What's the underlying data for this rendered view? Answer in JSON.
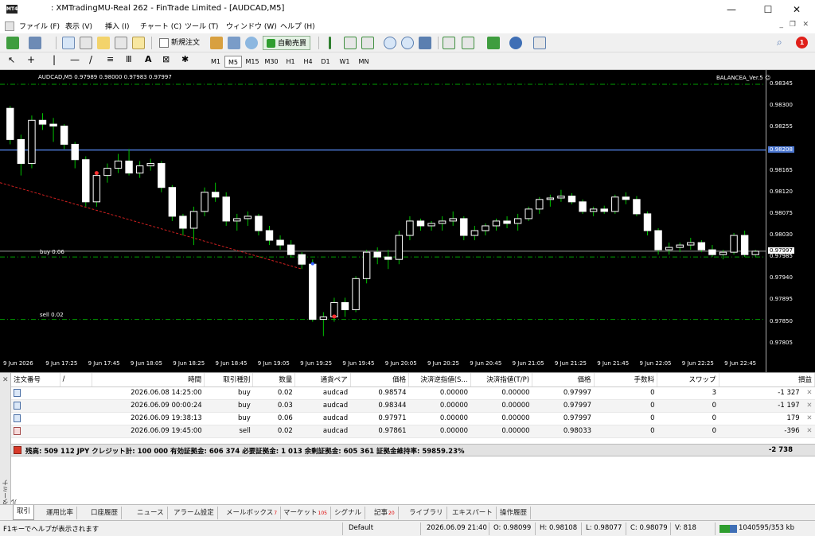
{
  "window": {
    "title": ": XMTradingMU-Real 262 - FinTrade Limited - [AUDCAD,M5]",
    "app_icon_text": "MT4",
    "controls": {
      "minimize": "—",
      "maximize": "☐",
      "close": "✕"
    }
  },
  "menu": [
    "ファイル (F)",
    "表示 (V)",
    "挿入 (I)",
    "チャート (C)",
    "ツール (T)",
    "ウィンドウ (W)",
    "ヘルプ (H)"
  ],
  "toolbar": {
    "new_order": "新規注文",
    "auto_trading": "自動売買",
    "notification_count": "1"
  },
  "timeframes": [
    "M1",
    "M5",
    "M15",
    "M30",
    "H1",
    "H4",
    "D1",
    "W1",
    "MN"
  ],
  "active_timeframe": "M5",
  "chart": {
    "info_header": "AUDCAD,M5 0.97989 0.98000 0.97983 0.97997",
    "ea_label": "BALANCEA_Ver.5",
    "colors": {
      "background": "#000000",
      "bull": "#ffffff",
      "bear": "#ffffff",
      "wick": "#00c000",
      "grid_line": "#00a000",
      "bid_line": "#4b77d1"
    },
    "order_labels": [
      {
        "text": "buy 0.06",
        "price": 0.97985
      },
      {
        "text": "sell 0.02",
        "price": 0.97855
      }
    ],
    "price_ticks": [
      "0.98345",
      "0.98300",
      "0.98255",
      "0.98208",
      "0.98165",
      "0.98120",
      "0.98075",
      "0.98030",
      "0.97997",
      "0.97985",
      "0.97940",
      "0.97895",
      "0.97850",
      "0.97805"
    ],
    "bid_price": "0.97997",
    "highlight_price": "0.98208",
    "time_ticks": [
      "9 Jun 2026",
      "9 Jun 17:25",
      "9 Jun 17:45",
      "9 Jun 18:05",
      "9 Jun 18:25",
      "9 Jun 18:45",
      "9 Jun 19:05",
      "9 Jun 19:25",
      "9 Jun 19:45",
      "9 Jun 20:05",
      "9 Jun 20:25",
      "9 Jun 20:45",
      "9 Jun 21:05",
      "9 Jun 21:25",
      "9 Jun 21:45",
      "9 Jun 22:05",
      "9 Jun 22:25",
      "9 Jun 22:45"
    ]
  },
  "chart_data": {
    "type": "candlestick",
    "symbol": "AUDCAD",
    "timeframe": "M5",
    "ylim": [
      0.97778,
      0.98365
    ],
    "reference_lines": {
      "bid": 0.97997,
      "highlight": 0.98208,
      "order_buy": 0.97985,
      "order_sell": 0.97855,
      "top_dash": 0.98345
    },
    "candles": [
      [
        0.98295,
        0.983,
        0.9822,
        0.9823
      ],
      [
        0.9823,
        0.9824,
        0.98155,
        0.9818
      ],
      [
        0.9818,
        0.9828,
        0.9817,
        0.9827
      ],
      [
        0.9827,
        0.98285,
        0.9825,
        0.98262
      ],
      [
        0.98262,
        0.98275,
        0.98225,
        0.98258
      ],
      [
        0.98258,
        0.98262,
        0.9821,
        0.9822
      ],
      [
        0.9822,
        0.98225,
        0.9817,
        0.98188
      ],
      [
        0.98188,
        0.98195,
        0.9809,
        0.981
      ],
      [
        0.981,
        0.9816,
        0.9809,
        0.98155
      ],
      [
        0.98155,
        0.9818,
        0.9814,
        0.9817
      ],
      [
        0.9817,
        0.982,
        0.9816,
        0.98185
      ],
      [
        0.98185,
        0.9821,
        0.98155,
        0.9816
      ],
      [
        0.9816,
        0.98185,
        0.9815,
        0.98175
      ],
      [
        0.98175,
        0.9819,
        0.98165,
        0.9818
      ],
      [
        0.9818,
        0.98185,
        0.9812,
        0.9813
      ],
      [
        0.9813,
        0.98135,
        0.9806,
        0.9807
      ],
      [
        0.9807,
        0.98075,
        0.9803,
        0.98045
      ],
      [
        0.98045,
        0.9809,
        0.9801,
        0.9808
      ],
      [
        0.9808,
        0.9813,
        0.9807,
        0.9812
      ],
      [
        0.9812,
        0.9814,
        0.981,
        0.9811
      ],
      [
        0.9811,
        0.9812,
        0.9805,
        0.9806
      ],
      [
        0.9806,
        0.98075,
        0.9804,
        0.98065
      ],
      [
        0.98065,
        0.9808,
        0.9805,
        0.9807
      ],
      [
        0.9807,
        0.98075,
        0.9803,
        0.9804
      ],
      [
        0.9804,
        0.9805,
        0.9801,
        0.9802
      ],
      [
        0.9802,
        0.9803,
        0.98,
        0.9801
      ],
      [
        0.9801,
        0.9802,
        0.97985,
        0.9799
      ],
      [
        0.9799,
        0.97995,
        0.9796,
        0.9797
      ],
      [
        0.9797,
        0.9798,
        0.9785,
        0.97855
      ],
      [
        0.97855,
        0.9787,
        0.9782,
        0.9786
      ],
      [
        0.9786,
        0.979,
        0.9785,
        0.9789
      ],
      [
        0.9789,
        0.979,
        0.9786,
        0.97875
      ],
      [
        0.97875,
        0.97945,
        0.9787,
        0.9794
      ],
      [
        0.9794,
        0.98,
        0.9793,
        0.97995
      ],
      [
        0.97995,
        0.98005,
        0.9797,
        0.97985
      ],
      [
        0.97985,
        0.98,
        0.9796,
        0.9798
      ],
      [
        0.9798,
        0.9804,
        0.9797,
        0.9803
      ],
      [
        0.9803,
        0.9807,
        0.9802,
        0.9806
      ],
      [
        0.9806,
        0.98065,
        0.9804,
        0.9805
      ],
      [
        0.9805,
        0.9806,
        0.9804,
        0.98055
      ],
      [
        0.98055,
        0.9807,
        0.9804,
        0.9806
      ],
      [
        0.9806,
        0.9808,
        0.9805,
        0.98065
      ],
      [
        0.98065,
        0.9807,
        0.9802,
        0.9803
      ],
      [
        0.9803,
        0.9805,
        0.9802,
        0.9804
      ],
      [
        0.9804,
        0.98055,
        0.9803,
        0.9805
      ],
      [
        0.9805,
        0.98065,
        0.9804,
        0.9806
      ],
      [
        0.9806,
        0.9807,
        0.98045,
        0.98055
      ],
      [
        0.98055,
        0.98075,
        0.9804,
        0.98065
      ],
      [
        0.98065,
        0.9809,
        0.9806,
        0.98085
      ],
      [
        0.98085,
        0.9811,
        0.98075,
        0.98105
      ],
      [
        0.98105,
        0.98115,
        0.9809,
        0.98108
      ],
      [
        0.98108,
        0.98125,
        0.981,
        0.98112
      ],
      [
        0.98112,
        0.98118,
        0.98095,
        0.981
      ],
      [
        0.981,
        0.98105,
        0.98075,
        0.9808
      ],
      [
        0.9808,
        0.9809,
        0.9807,
        0.98085
      ],
      [
        0.98085,
        0.98092,
        0.98075,
        0.9808
      ],
      [
        0.9808,
        0.98115,
        0.98075,
        0.9811
      ],
      [
        0.9811,
        0.9812,
        0.98095,
        0.98105
      ],
      [
        0.98105,
        0.98112,
        0.9807,
        0.98075
      ],
      [
        0.98075,
        0.9808,
        0.9803,
        0.9804
      ],
      [
        0.9804,
        0.98045,
        0.9799,
        0.98
      ],
      [
        0.98,
        0.98015,
        0.9799,
        0.98005
      ],
      [
        0.98005,
        0.98015,
        0.97995,
        0.9801
      ],
      [
        0.9801,
        0.98025,
        0.98,
        0.98015
      ],
      [
        0.98015,
        0.9802,
        0.97995,
        0.98
      ],
      [
        0.98,
        0.9801,
        0.97985,
        0.9799
      ],
      [
        0.9799,
        0.98,
        0.9798,
        0.97995
      ],
      [
        0.97995,
        0.98035,
        0.9799,
        0.9803
      ],
      [
        0.9803,
        0.9804,
        0.97985,
        0.9799
      ],
      [
        0.9799,
        0.98,
        0.97985,
        0.97997
      ]
    ]
  },
  "terminal": {
    "side_label": "ターミナル",
    "headers": [
      "注文番号",
      "/",
      "時間",
      "取引種別",
      "数量",
      "通貨ペア",
      "価格",
      "決済逆指値(S...",
      "決済指値(T/P)",
      "価格",
      "手数料",
      "スワップ",
      "損益"
    ],
    "orders": [
      {
        "type": "buy",
        "time": "2026.06.08 14:25:00",
        "volume": "0.02",
        "symbol": "audcad",
        "price": "0.98574",
        "sl": "0.00000",
        "tp": "0.00000",
        "current": "0.97997",
        "commission": "0",
        "swap": "3",
        "profit": "-1 327"
      },
      {
        "type": "buy",
        "time": "2026.06.09 00:00:24",
        "volume": "0.03",
        "symbol": "audcad",
        "price": "0.98344",
        "sl": "0.00000",
        "tp": "0.00000",
        "current": "0.97997",
        "commission": "0",
        "swap": "0",
        "profit": "-1 197"
      },
      {
        "type": "buy",
        "time": "2026.06.09 19:38:13",
        "volume": "0.06",
        "symbol": "audcad",
        "price": "0.97971",
        "sl": "0.00000",
        "tp": "0.00000",
        "current": "0.97997",
        "commission": "0",
        "swap": "0",
        "profit": "179"
      },
      {
        "type": "sell",
        "time": "2026.06.09 19:45:00",
        "volume": "0.02",
        "symbol": "audcad",
        "price": "0.97861",
        "sl": "0.00000",
        "tp": "0.00000",
        "current": "0.98033",
        "commission": "0",
        "swap": "0",
        "profit": "-396"
      }
    ],
    "summary": "残高: 509 112 JPY  クレジット計: 100 000  有効証拠金: 606 374  必要証拠金: 1 013  余剰証拠金: 605 361  証拠金維持率: 59859.23%",
    "summary_total": "-2 738",
    "close_glyph": "✕",
    "tabs": [
      {
        "label": "取引",
        "badge": ""
      },
      {
        "label": "運用比率",
        "badge": ""
      },
      {
        "label": "口座履歴",
        "badge": ""
      },
      {
        "label": "ニュース",
        "badge": ""
      },
      {
        "label": "アラーム設定",
        "badge": ""
      },
      {
        "label": "メールボックス",
        "badge": "7"
      },
      {
        "label": "マーケット",
        "badge": "105"
      },
      {
        "label": "シグナル",
        "badge": ""
      },
      {
        "label": "記事",
        "badge": "20"
      },
      {
        "label": "ライブラリ",
        "badge": ""
      },
      {
        "label": "エキスパート",
        "badge": ""
      },
      {
        "label": "操作履歴",
        "badge": ""
      }
    ]
  },
  "status": {
    "help": "F1キーでヘルプが表示されます",
    "profile": "Default",
    "datetime": "2026.06.09 21:40",
    "open": "O: 0.98099",
    "high": "H: 0.98108",
    "low": "L: 0.98077",
    "close": "C: 0.98079",
    "volume": "V: 818",
    "traffic": "1040595/353 kb"
  }
}
